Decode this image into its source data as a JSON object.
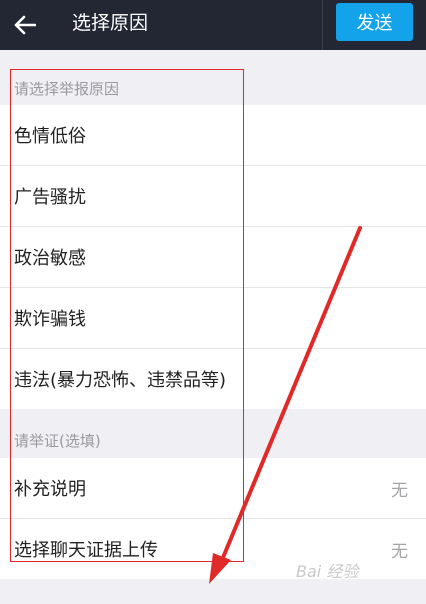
{
  "header": {
    "title": "选择原因",
    "send_label": "发送"
  },
  "reasons": {
    "section_label": "请选择举报原因",
    "items": [
      {
        "label": "色情低俗"
      },
      {
        "label": "广告骚扰"
      },
      {
        "label": "政治敏感"
      },
      {
        "label": "欺诈骗钱"
      },
      {
        "label": "违法(暴力恐怖、违禁品等)"
      }
    ]
  },
  "evidence": {
    "section_label": "请举证(选填)",
    "items": [
      {
        "label": "补充说明",
        "value": "无"
      },
      {
        "label": "选择聊天证据上传",
        "value": "无"
      }
    ]
  },
  "watermark": "Bai 经验",
  "colors": {
    "topbar": "#232733",
    "accent": "#12a3ea",
    "annotation": "#e02a2a"
  }
}
